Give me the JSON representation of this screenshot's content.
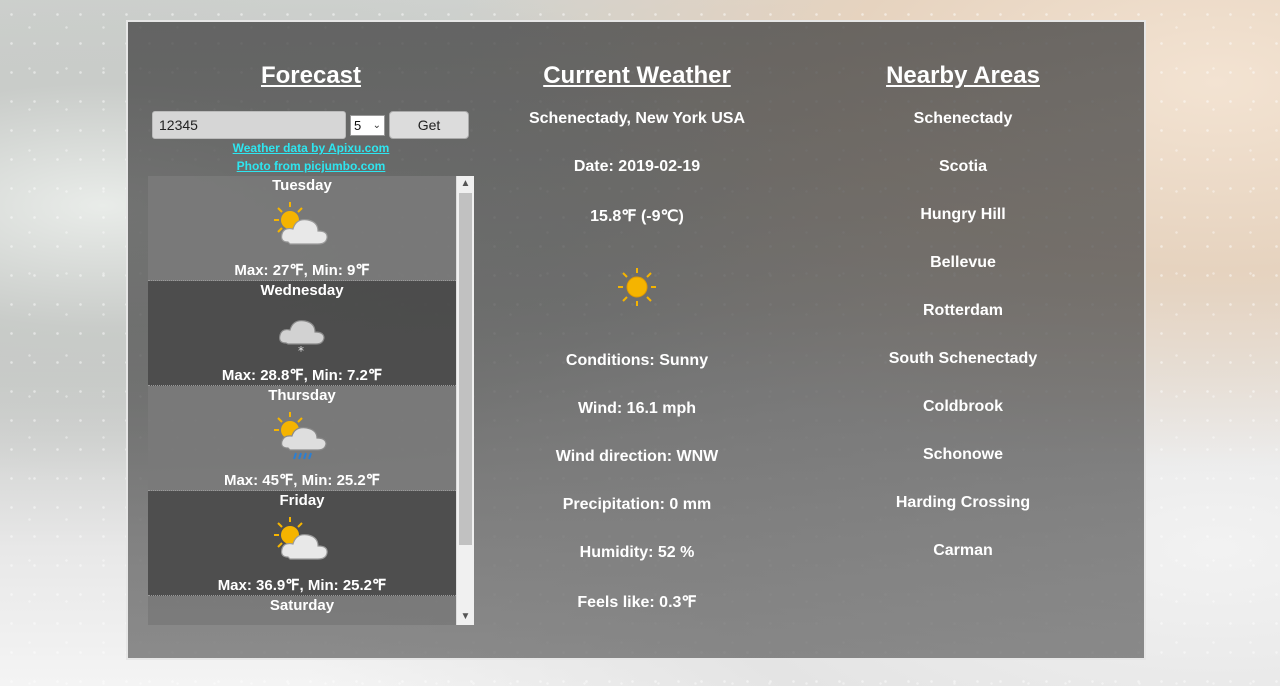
{
  "forecast": {
    "title": "Forecast",
    "zip_value": "12345",
    "days_value": "5",
    "get_label": "Get",
    "credit_weather": "Weather data by Apixu.com",
    "credit_photo": "Photo from picjumbo.com",
    "days": [
      {
        "name": "Tuesday",
        "icon": "partly-cloudy-icon",
        "temp": "Max: 27℉, Min: 9℉"
      },
      {
        "name": "Wednesday",
        "icon": "snow-cloud-icon",
        "temp": "Max: 28.8℉, Min: 7.2℉"
      },
      {
        "name": "Thursday",
        "icon": "sun-rain-cloud-icon",
        "temp": "Max: 45℉, Min: 25.2℉"
      },
      {
        "name": "Friday",
        "icon": "partly-cloudy-icon",
        "temp": "Max: 36.9℉, Min: 25.2℉"
      },
      {
        "name": "Saturday",
        "icon": "",
        "temp": ""
      }
    ]
  },
  "current": {
    "title": "Current Weather",
    "location": "Schenectady, New York USA",
    "date": "Date: 2019-02-19",
    "temperature": "15.8℉ (-9℃)",
    "icon": "sun-icon",
    "conditions": "Conditions: Sunny",
    "wind": "Wind: 16.1 mph",
    "wind_direction": "Wind direction: WNW",
    "precipitation": "Precipitation: 0 mm",
    "humidity": "Humidity: 52 %",
    "feels_like": "Feels like: 0.3℉"
  },
  "nearby": {
    "title": "Nearby Areas",
    "areas": [
      "Schenectady",
      "Scotia",
      "Hungry Hill",
      "Bellevue",
      "Rotterdam",
      "South Schenectady",
      "Coldbrook",
      "Schonowe",
      "Harding Crossing",
      "Carman"
    ]
  },
  "colors": {
    "link": "#2ee6f0",
    "sun": "#f5b400",
    "cloud": "#e6e6e6",
    "rain": "#2a7fd4"
  }
}
